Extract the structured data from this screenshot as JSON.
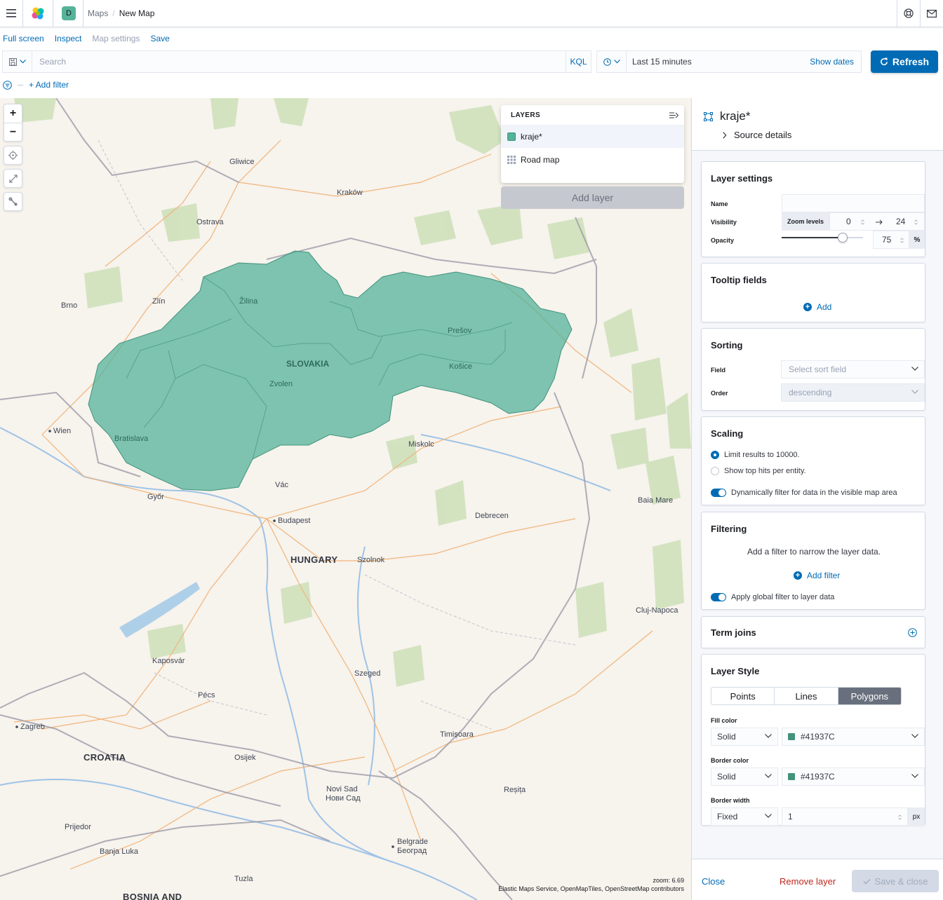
{
  "header": {
    "breadcrumbs": [
      "Maps",
      "New Map"
    ],
    "space_initial": "D"
  },
  "topnav": {
    "full_screen": "Full screen",
    "inspect": "Inspect",
    "map_settings": "Map settings",
    "save": "Save"
  },
  "query": {
    "placeholder": "Search",
    "language": "KQL"
  },
  "time": {
    "range": "Last 15 minutes",
    "show_dates": "Show dates",
    "refresh": "Refresh"
  },
  "filters": {
    "add_filter": "+ Add filter"
  },
  "map": {
    "zoom_in": "+",
    "zoom_out": "−",
    "zoom_readout": "zoom: 6.69",
    "attribution": "Elastic Maps Service, OpenMapTiles, OpenStreetMap contributors",
    "labels": {
      "slovakia": "SLOVAKIA",
      "hungary": "HUNGARY",
      "croatia": "CROATIA",
      "bosnia": "BOSNIA AND",
      "gliwice": "Gliwice",
      "krakow": "Kraków",
      "ostrava": "Ostrava",
      "zlin": "Zlín",
      "brno": "Brno",
      "zilina": "Žilina",
      "presov": "Prešov",
      "kosice": "Košice",
      "zvolen": "Zvolen",
      "wien": "Wien",
      "bratislava": "Bratislava",
      "miskolc": "Miskolc",
      "vac": "Vác",
      "gyor": "Győr",
      "budapest": "Budapest",
      "debrecen": "Debrecen",
      "baia_mare": "Baia Mare",
      "szolnok": "Szolnok",
      "cluj": "Cluj-Napoca",
      "kaposvar": "Kaposvár",
      "szeged": "Szeged",
      "pecs": "Pécs",
      "zagreb": "Zagreb",
      "osijek": "Osijek",
      "timisoara": "Timișoara",
      "novi_sad": "Novi Sad",
      "novi_sad_cyr": "Нови Сад",
      "resita": "Reșița",
      "prijedor": "Prijedor",
      "banja_luka": "Banja Luka",
      "belgrade": "Belgrade",
      "belgrade_cyr": "Београд",
      "tuzla": "Tuzla"
    }
  },
  "layers_panel": {
    "title": "LAYERS",
    "items": [
      {
        "name": "kraje*",
        "swatch": "#54b399"
      },
      {
        "name": "Road map"
      }
    ],
    "add_layer": "Add layer"
  },
  "editor": {
    "title": "kraje*",
    "source_details": "Source details",
    "layer_settings": {
      "heading": "Layer settings",
      "name_label": "Name",
      "name_value": "",
      "visibility_label": "Visibility",
      "zoom_levels": "Zoom levels",
      "min_zoom": "0",
      "max_zoom": "24",
      "opacity_label": "Opacity",
      "opacity_value": "75",
      "opacity_unit": "%",
      "opacity_fraction": 0.75
    },
    "tooltip": {
      "heading": "Tooltip fields",
      "add": "Add"
    },
    "sorting": {
      "heading": "Sorting",
      "field_label": "Field",
      "field_placeholder": "Select sort field",
      "order_label": "Order",
      "order_value": "descending"
    },
    "scaling": {
      "heading": "Scaling",
      "option_limit": "Limit results to 10000.",
      "option_top_hits": "Show top hits per entity.",
      "dynamic_filter": "Dynamically filter for data in the visible map area"
    },
    "filtering": {
      "heading": "Filtering",
      "help": "Add a filter to narrow the layer data.",
      "add_filter": "Add filter",
      "apply_global": "Apply global filter to layer data"
    },
    "term_joins": {
      "heading": "Term joins"
    },
    "style": {
      "heading": "Layer Style",
      "tabs": [
        "Points",
        "Lines",
        "Polygons"
      ],
      "fill_color_label": "Fill color",
      "fill_type": "Solid",
      "fill_color": "#41937C",
      "border_color_label": "Border color",
      "border_type": "Solid",
      "border_color": "#41937C",
      "border_width_label": "Border width",
      "border_width_type": "Fixed",
      "border_width_value": "1",
      "border_width_unit": "px"
    },
    "footer": {
      "close": "Close",
      "remove": "Remove layer",
      "save": "Save & close"
    }
  }
}
